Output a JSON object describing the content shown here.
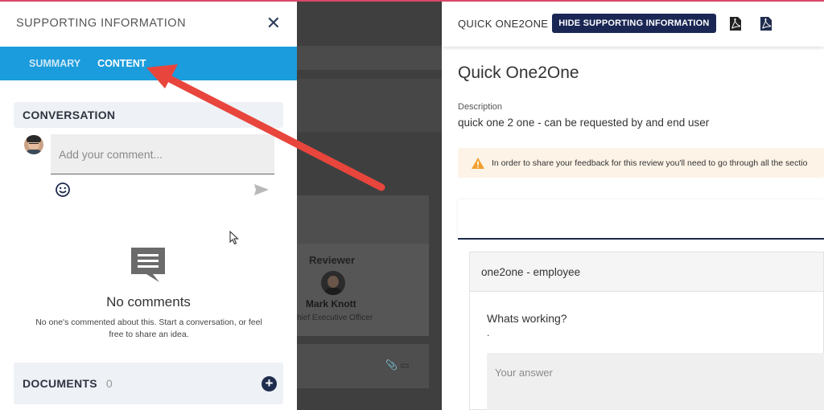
{
  "supporting_panel": {
    "title": "SUPPORTING INFORMATION",
    "close_icon": "close-icon",
    "tabs": [
      {
        "label": "SUMMARY",
        "active": false
      },
      {
        "label": "CONTENT",
        "active": true
      }
    ],
    "conversation": {
      "heading": "CONVERSATION",
      "comment_placeholder": "Add your comment...",
      "empty_title": "No comments",
      "empty_text": "No one's commented about this. Start a conversation, or feel free to share an idea."
    },
    "documents": {
      "heading": "DOCUMENTS",
      "count": "0"
    }
  },
  "background_card": {
    "reviewer_label": "Reviewer",
    "reviewer_name": "Mark Knott",
    "reviewer_role": "hief Executive Officer"
  },
  "review_panel": {
    "header_title": "QUICK ONE2ONE",
    "hide_button": "HIDE SUPPORTING INFORMATION",
    "heading": "Quick One2One",
    "description_label": "Description",
    "description": "quick one 2 one - can be requested by and end user",
    "warning": "In order to share your feedback for this review you'll need to go through all the sectio",
    "section_title": "one2one - employee",
    "question": "Whats working?",
    "question_hint": ".",
    "answer_placeholder": "Your answer"
  },
  "colors": {
    "tab_bar": "#1b9cdc",
    "navy": "#1a2755",
    "annotation_arrow": "#e8453c",
    "warning_bg": "#fdf3e6",
    "warning_icon": "#f0a030"
  }
}
